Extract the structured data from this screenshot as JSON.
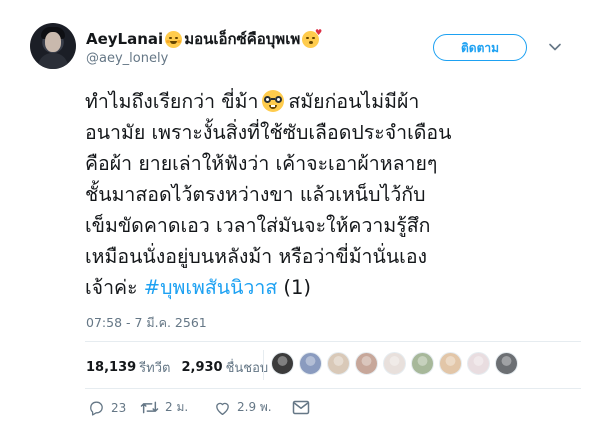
{
  "author": {
    "display_name": "AeyLanai",
    "display_name_suffix": "มอนเอ็กซ์คือบุพเพ",
    "handle": "@aey_lonely"
  },
  "follow_button": {
    "label": "ติดตาม"
  },
  "tweet": {
    "lines": [
      "ทำไมถึงเรียกว่า ขี่ม้า",
      "อนามัย เพราะงั้นสิ่งที่ใช้ซับเลือดประจำเดือน",
      "คือผ้า ยายเล่าให้ฟังว่า เค้าจะเอาผ้าหลายๆ",
      "ชั้นมาสอดไว้ตรงหว่างขา แล้วเหน็บไว้กับ",
      "เข็มขัดคาดเอว เวลาใส่มันจะให้ความรู้สึก",
      "เหมือนนั่งอยู่บนหลังม้า หรือว่าขี่ม้านั่นเอง",
      "เจ้าค่ะ"
    ],
    "line1_after_emoji": "สมัยก่อนไม่มีผ้า",
    "hashtag": "#บุพเพสันนิวาส",
    "hashtag_suffix": "(1)",
    "timestamp": "07:58 - 7 มี.ค. 2561"
  },
  "stats": {
    "retweets_count": "18,139",
    "retweets_label": "รีทวีต",
    "likes_count": "2,930",
    "likes_label": "ชื่นชอบ"
  },
  "likers": [
    {
      "icon": "avatar",
      "color": "#3b3b3b"
    },
    {
      "icon": "avatar",
      "color": "#8a9bbf"
    },
    {
      "icon": "avatar",
      "color": "#d9c9b8"
    },
    {
      "icon": "avatar",
      "color": "#c7a79a"
    },
    {
      "icon": "avatar",
      "color": "#e8e0dc"
    },
    {
      "icon": "avatar",
      "color": "#a7b89a"
    },
    {
      "icon": "avatar",
      "color": "#e2c6a8"
    },
    {
      "icon": "avatar",
      "color": "#e9dde0"
    },
    {
      "icon": "avatar",
      "color": "#6c6f73"
    }
  ],
  "actions": {
    "reply_count": "23",
    "retweet_count": "2 ม.",
    "like_count": "2.9 พ."
  },
  "colors": {
    "accent": "#1da1f2",
    "muted": "#657786",
    "text": "#14171a"
  }
}
